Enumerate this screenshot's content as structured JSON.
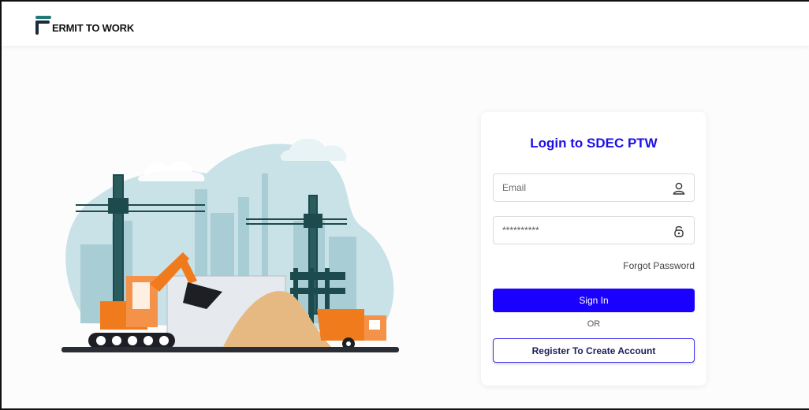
{
  "header": {
    "brand_text": "ERMIT TO WORK",
    "brand_initial": "P"
  },
  "login": {
    "title": "Login to SDEC PTW",
    "email_placeholder": "Email",
    "password_value": "**********",
    "forgot_label": "Forgot Password",
    "signin_label": "Sign In",
    "or_label": "OR",
    "register_label": "Register To Create Account"
  },
  "icons": {
    "email": "user-icon",
    "password": "lock-icon",
    "logo": "permit-logo-icon"
  },
  "colors": {
    "accent": "#1a00ff",
    "title": "#1c10e6",
    "logo_teal": "#1f7a78",
    "logo_dark": "#1d2a38",
    "excavator": "#f07b1c",
    "sky_blob": "#c9e2e7"
  }
}
